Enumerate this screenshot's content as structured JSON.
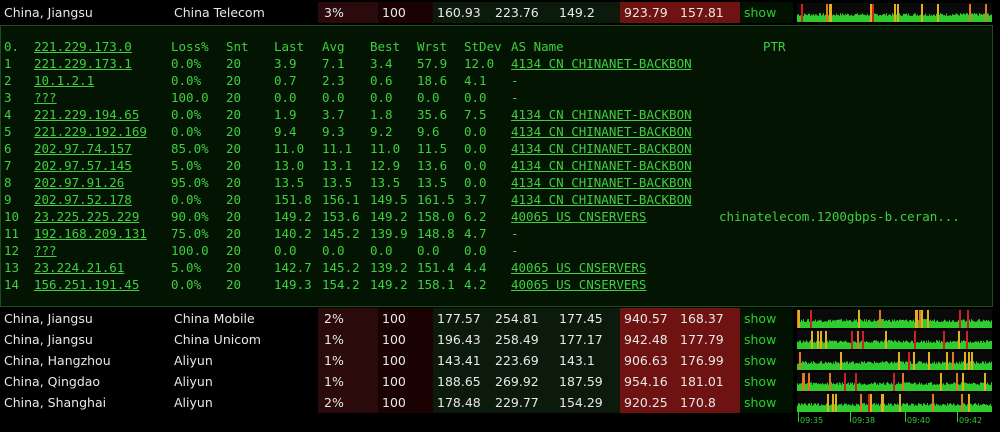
{
  "top_row": {
    "location": "China, Jiangsu",
    "isp": "China Telecom",
    "loss": "3%",
    "sent": "100",
    "avg": "160.93",
    "max": "223.76",
    "min": "149.2",
    "jitter": "923.79",
    "stdev": "157.81",
    "action": "show"
  },
  "mtr": {
    "headers": {
      "n": "0.",
      "ip": "221.229.173.0",
      "loss": "Loss%",
      "snt": "Snt",
      "last": "Last",
      "avg": "Avg",
      "best": "Best",
      "wrst": "Wrst",
      "stdev": "StDev",
      "as": "AS Name",
      "ptr": "PTR"
    },
    "hops": [
      {
        "n": "1",
        "ip": "221.229.173.1",
        "loss": "0.0%",
        "snt": "20",
        "last": "3.9",
        "avg": "7.1",
        "best": "3.4",
        "wrst": "57.9",
        "std": "12.0",
        "as": "4134  CN CHINANET-BACKBON",
        "ptr": ""
      },
      {
        "n": "2",
        "ip": "10.1.2.1",
        "loss": "0.0%",
        "snt": "20",
        "last": "0.7",
        "avg": "2.3",
        "best": "0.6",
        "wrst": "18.6",
        "std": "4.1",
        "as": "-",
        "ptr": ""
      },
      {
        "n": "3",
        "ip": "???",
        "loss": "100.0",
        "snt": "20",
        "last": "0.0",
        "avg": "0.0",
        "best": "0.0",
        "wrst": "0.0",
        "std": "0.0",
        "as": "-",
        "ptr": ""
      },
      {
        "n": "4",
        "ip": "221.229.194.65",
        "loss": "0.0%",
        "snt": "20",
        "last": "1.9",
        "avg": "3.7",
        "best": "1.8",
        "wrst": "35.6",
        "std": "7.5",
        "as": "4134  CN CHINANET-BACKBON",
        "ptr": ""
      },
      {
        "n": "5",
        "ip": "221.229.192.169",
        "loss": "0.0%",
        "snt": "20",
        "last": "9.4",
        "avg": "9.3",
        "best": "9.2",
        "wrst": "9.6",
        "std": "0.0",
        "as": "4134  CN CHINANET-BACKBON",
        "ptr": ""
      },
      {
        "n": "6",
        "ip": "202.97.74.157",
        "loss": "85.0%",
        "snt": "20",
        "last": "11.0",
        "avg": "11.1",
        "best": "11.0",
        "wrst": "11.5",
        "std": "0.0",
        "as": "4134  CN CHINANET-BACKBON",
        "ptr": ""
      },
      {
        "n": "7",
        "ip": "202.97.57.145",
        "loss": "5.0%",
        "snt": "20",
        "last": "13.0",
        "avg": "13.1",
        "best": "12.9",
        "wrst": "13.6",
        "std": "0.0",
        "as": "4134  CN CHINANET-BACKBON",
        "ptr": ""
      },
      {
        "n": "8",
        "ip": "202.97.91.26",
        "loss": "95.0%",
        "snt": "20",
        "last": "13.5",
        "avg": "13.5",
        "best": "13.5",
        "wrst": "13.5",
        "std": "0.0",
        "as": "4134  CN CHINANET-BACKBON",
        "ptr": ""
      },
      {
        "n": "9",
        "ip": "202.97.52.178",
        "loss": "0.0%",
        "snt": "20",
        "last": "151.8",
        "avg": "156.1",
        "best": "149.5",
        "wrst": "161.5",
        "std": "3.7",
        "as": "4134  CN CHINANET-BACKBON",
        "ptr": ""
      },
      {
        "n": "10",
        "ip": "23.225.225.229",
        "loss": "90.0%",
        "snt": "20",
        "last": "149.2",
        "avg": "153.6",
        "best": "149.2",
        "wrst": "158.0",
        "std": "6.2",
        "as": "40065 US CNSERVERS",
        "ptr": "chinatelecom.1200gbps-b.ceran..."
      },
      {
        "n": "11",
        "ip": "192.168.209.131",
        "loss": "75.0%",
        "snt": "20",
        "last": "140.2",
        "avg": "145.2",
        "best": "139.9",
        "wrst": "148.8",
        "std": "4.7",
        "as": "-",
        "ptr": ""
      },
      {
        "n": "12",
        "ip": "???",
        "loss": "100.0",
        "snt": "20",
        "last": "0.0",
        "avg": "0.0",
        "best": "0.0",
        "wrst": "0.0",
        "std": "0.0",
        "as": "-",
        "ptr": ""
      },
      {
        "n": "13",
        "ip": "23.224.21.61",
        "loss": "5.0%",
        "snt": "20",
        "last": "142.7",
        "avg": "145.2",
        "best": "139.2",
        "wrst": "151.4",
        "std": "4.4",
        "as": "40065 US CNSERVERS",
        "ptr": ""
      },
      {
        "n": "14",
        "ip": "156.251.191.45",
        "loss": "0.0%",
        "snt": "20",
        "last": "149.3",
        "avg": "154.2",
        "best": "149.2",
        "wrst": "158.1",
        "std": "4.2",
        "as": "40065 US CNSERVERS",
        "ptr": ""
      }
    ]
  },
  "rows": [
    {
      "location": "China, Jiangsu",
      "isp": "China Mobile",
      "loss": "2%",
      "sent": "100",
      "avg": "177.57",
      "max": "254.81",
      "min": "177.45",
      "jitter": "940.57",
      "stdev": "168.37",
      "action": "show"
    },
    {
      "location": "China, Jiangsu",
      "isp": "China Unicom",
      "loss": "1%",
      "sent": "100",
      "avg": "196.43",
      "max": "258.49",
      "min": "177.17",
      "jitter": "942.48",
      "stdev": "177.79",
      "action": "show"
    },
    {
      "location": "China, Hangzhou",
      "isp": "Aliyun",
      "loss": "1%",
      "sent": "100",
      "avg": "143.41",
      "max": "223.69",
      "min": "143.1",
      "jitter": "906.63",
      "stdev": "176.99",
      "action": "show"
    },
    {
      "location": "China, Qingdao",
      "isp": "Aliyun",
      "loss": "1%",
      "sent": "100",
      "avg": "188.65",
      "max": "269.92",
      "min": "187.59",
      "jitter": "954.16",
      "stdev": "181.01",
      "action": "show"
    },
    {
      "location": "China, Shanghai",
      "isp": "Aliyun",
      "loss": "2%",
      "sent": "100",
      "avg": "178.48",
      "max": "229.77",
      "min": "154.29",
      "jitter": "920.25",
      "stdev": "170.8",
      "action": "show"
    }
  ],
  "time_axis": [
    "09:35",
    "09:38",
    "09:40",
    "09:42"
  ],
  "colors": {
    "green": "#2ecc2e",
    "yellow": "#e0b020",
    "orange": "#e07a20",
    "red": "#d02020",
    "bg_red": "#6e1212"
  }
}
